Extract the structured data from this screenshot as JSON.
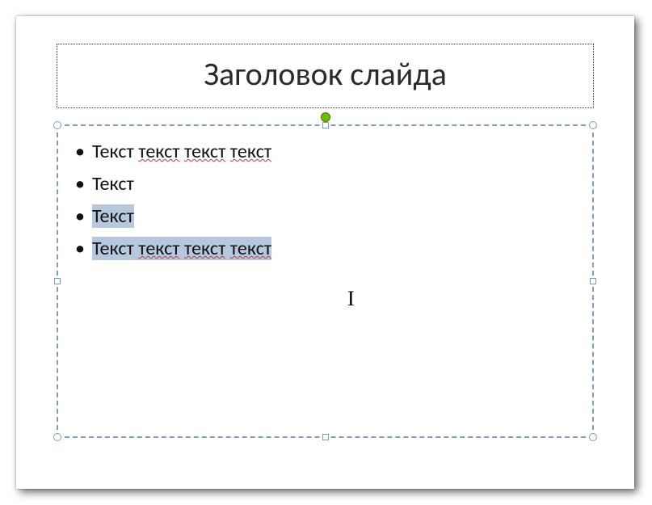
{
  "title": {
    "text": "Заголовок слайда"
  },
  "body": {
    "lines": [
      {
        "segments": [
          {
            "t": "Текст ",
            "selected": false,
            "squiggle": false
          },
          {
            "t": "текст",
            "selected": false,
            "squiggle": true
          },
          {
            "t": " ",
            "selected": false,
            "squiggle": false
          },
          {
            "t": "текст",
            "selected": false,
            "squiggle": true
          },
          {
            "t": " ",
            "selected": false,
            "squiggle": false
          },
          {
            "t": "текст",
            "selected": false,
            "squiggle": true
          }
        ]
      },
      {
        "segments": [
          {
            "t": "Текст",
            "selected": false,
            "squiggle": false
          }
        ]
      },
      {
        "segments": [
          {
            "t": "Текст",
            "selected": true,
            "squiggle": false
          }
        ]
      },
      {
        "segments": [
          {
            "t": "Текст ",
            "selected": true,
            "squiggle": false
          },
          {
            "t": "текст",
            "selected": true,
            "squiggle": true
          },
          {
            "t": " ",
            "selected": true,
            "squiggle": false
          },
          {
            "t": "текст",
            "selected": true,
            "squiggle": true
          },
          {
            "t": " ",
            "selected": true,
            "squiggle": false
          },
          {
            "t": "текст",
            "selected": true,
            "squiggle": true
          }
        ]
      }
    ]
  },
  "bullet_char": "•",
  "caret_glyph": "I"
}
